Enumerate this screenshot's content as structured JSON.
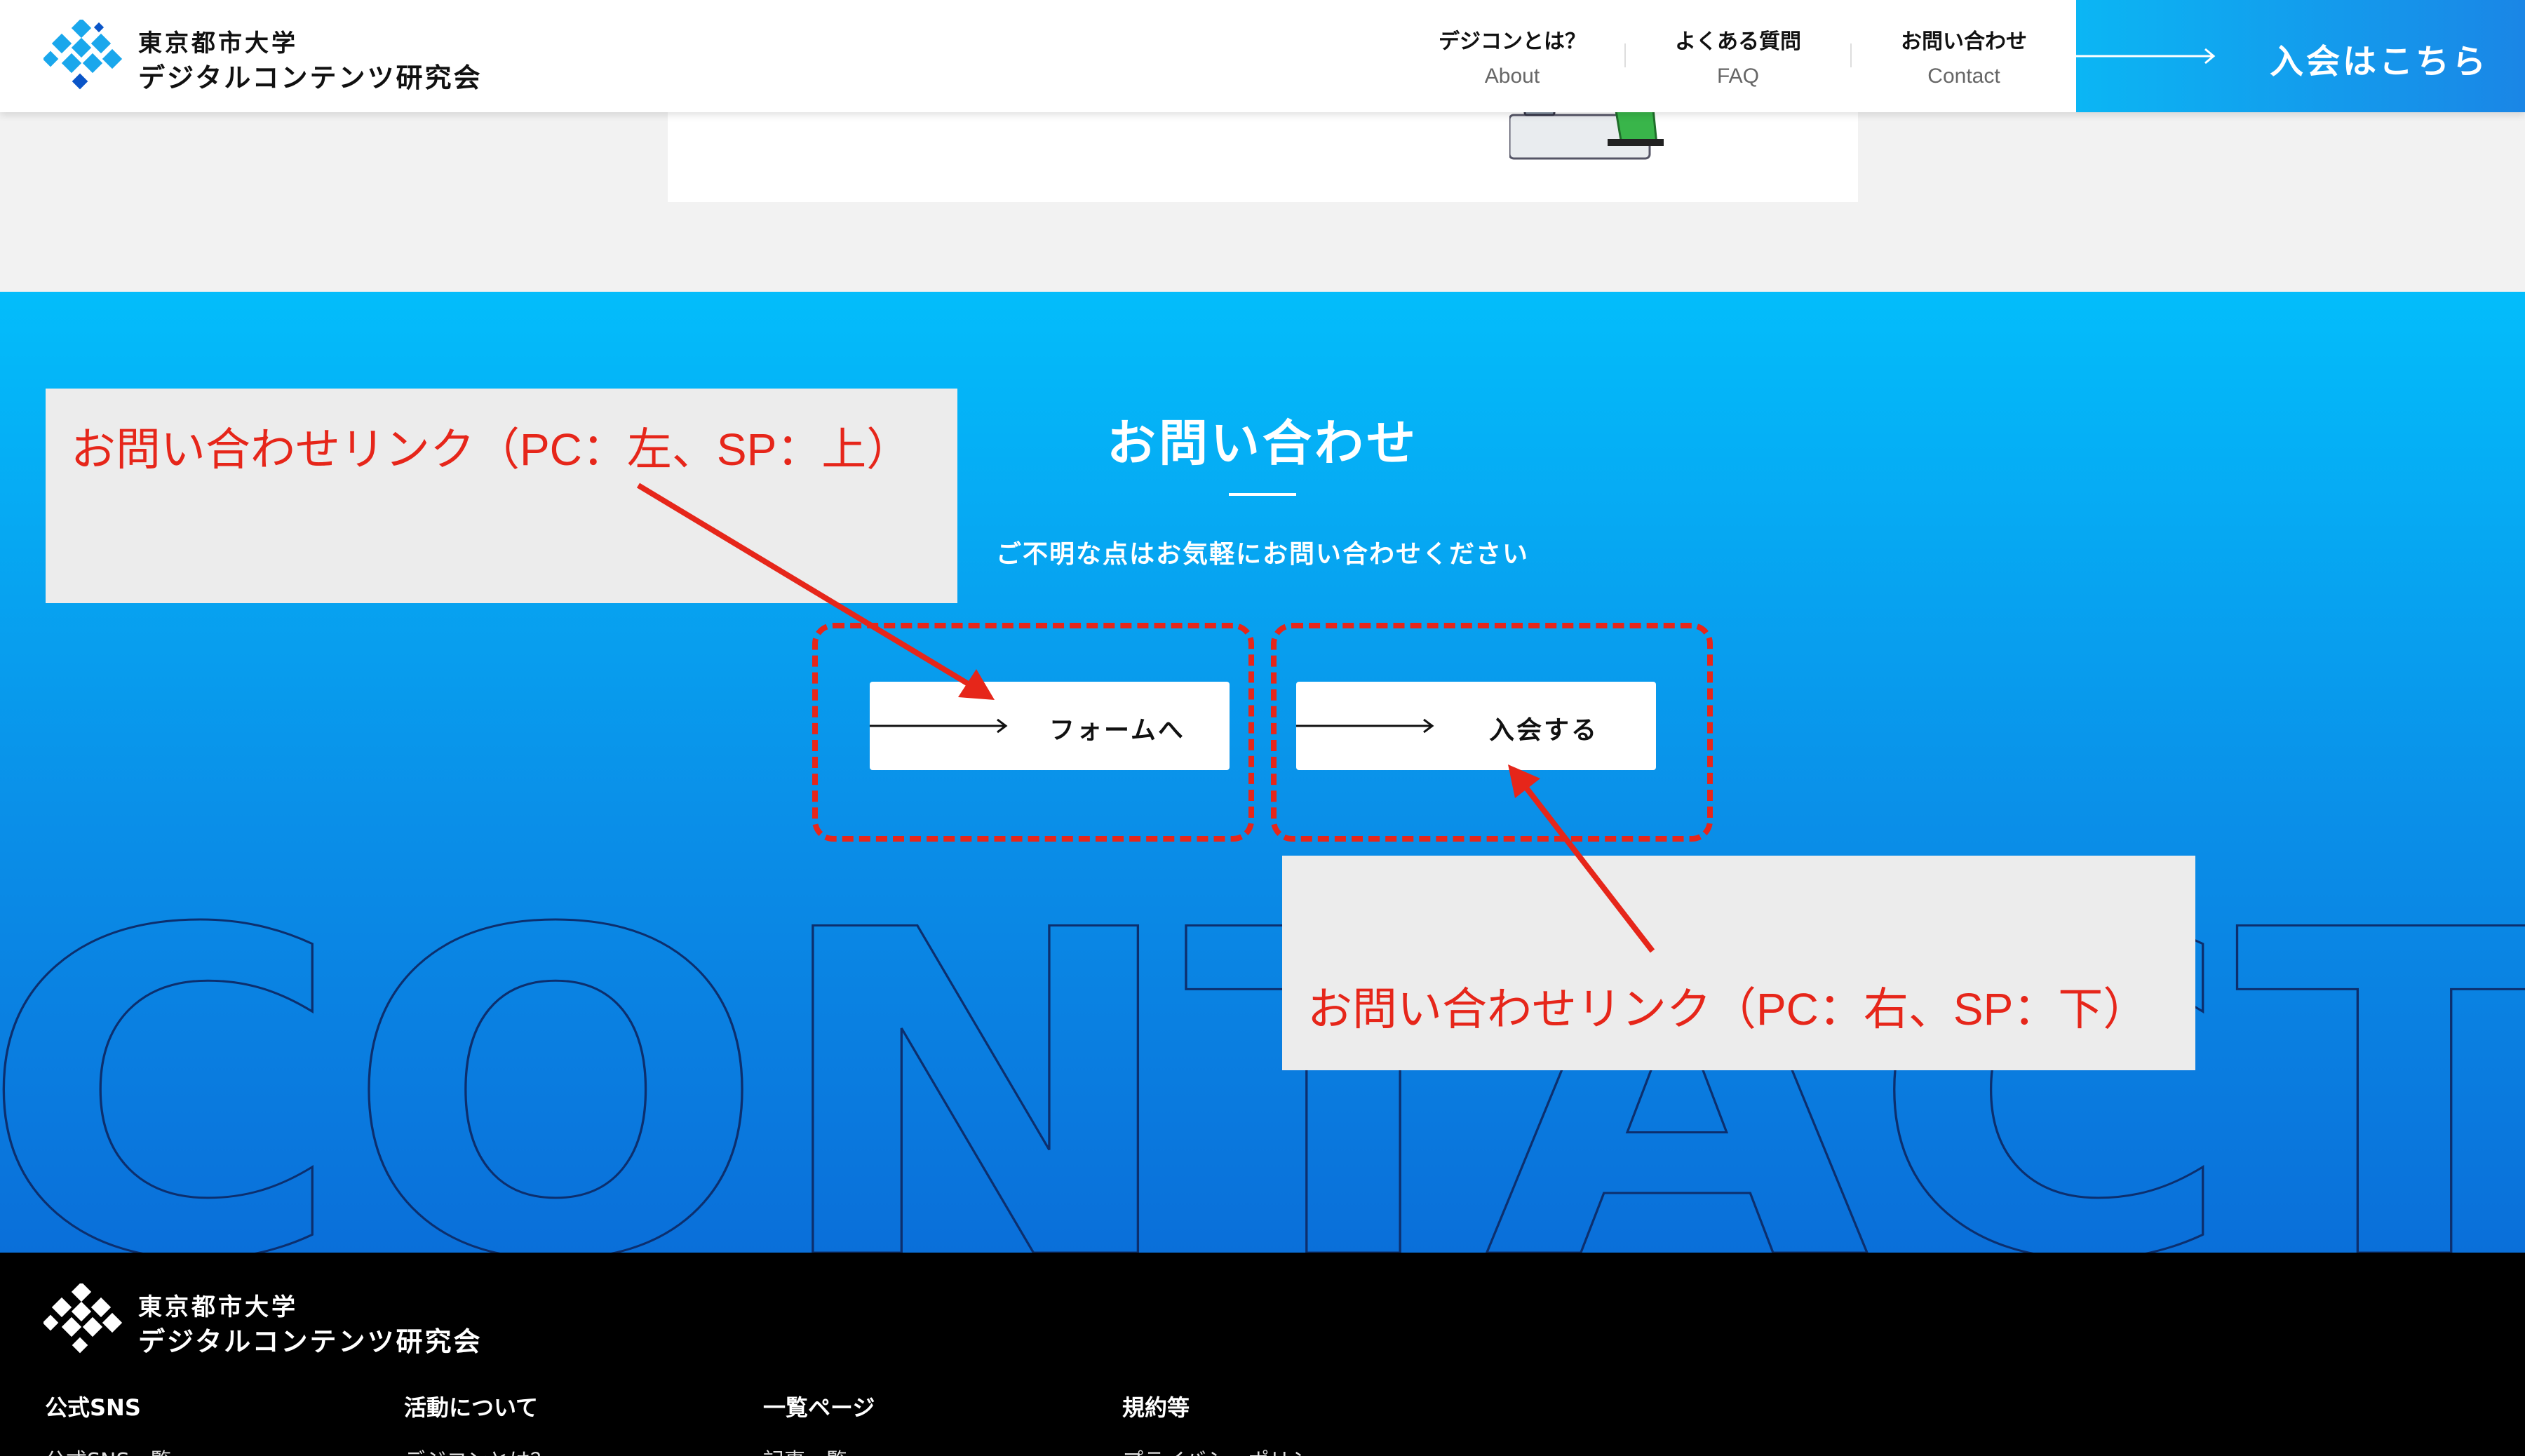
{
  "header": {
    "logo": {
      "line1": "東京都市大学",
      "line2": "デジタルコンテンツ研究会"
    },
    "nav": [
      {
        "ja": "デジコンとは？",
        "en": "About"
      },
      {
        "ja": "よくある質問",
        "en": "FAQ"
      },
      {
        "ja": "お問い合わせ",
        "en": "Contact"
      }
    ],
    "join_label": "入会はこちら"
  },
  "contact": {
    "title": "お問い合わせ",
    "subtitle": "ご不明な点はお気軽にお問い合わせください",
    "background_word": "CONTACT",
    "buttons": [
      {
        "label": "フォームへ"
      },
      {
        "label": "入会する"
      }
    ]
  },
  "annotations": {
    "left_note": "お問い合わせリンク（PC：左、SP：上）",
    "right_note": "お問い合わせリンク（PC：右、SP：下）"
  },
  "footer": {
    "logo": {
      "line1": "東京都市大学",
      "line2": "デジタルコンテンツ研究会"
    },
    "columns": [
      {
        "heading": "公式SNS",
        "item": "公式SNS一覧"
      },
      {
        "heading": "活動について",
        "item": "デジコンとは？"
      },
      {
        "heading": "一覧ページ",
        "item": "記事一覧"
      },
      {
        "heading": "規約等",
        "item": "プライバシーポリシー"
      }
    ]
  },
  "colors": {
    "accent_blue": "#03bdfb",
    "deep_blue": "#0a6fd9",
    "annotation_red": "#e6261a",
    "note_bg": "#ececec"
  }
}
